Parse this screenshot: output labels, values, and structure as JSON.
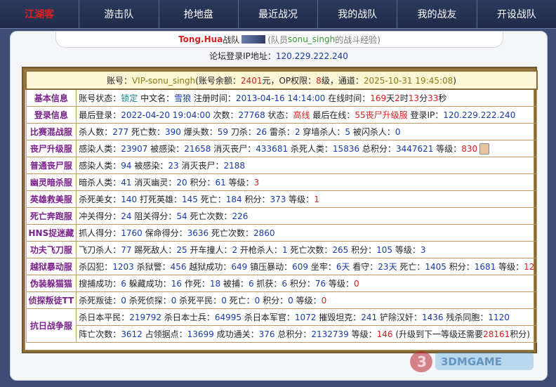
{
  "nav": {
    "logo": "江湖客",
    "items": [
      "游击队",
      "抢地盘",
      "最近战况",
      "我的战队",
      "我的战友",
      "开设战队"
    ]
  },
  "header": {
    "team_name": "Tong.Hua",
    "team_suffix": "战队",
    "member_prefix": "(队员",
    "member_name": "sonu_singh",
    "member_suffix": "的战斗经验)"
  },
  "ip": {
    "label": "论坛登录IP地址：",
    "value": "120.229.222.240"
  },
  "account": {
    "label": "账号：",
    "id": "VIP-sonu_singh",
    "balance_label": "(账号余额：",
    "balance": "2401",
    "balance_unit": "元，OP权限：",
    "op_level": "8",
    "op_unit": "级，通道：",
    "date": "2025-10-31 19:45:08",
    "close": ")"
  },
  "rows": [
    {
      "label": "基本信息",
      "parts": [
        {
          "t": "账号状态：",
          "c": ""
        },
        {
          "t": "锁定",
          "c": "teal"
        },
        {
          "t": " 中文名：",
          "c": ""
        },
        {
          "t": "雪狼",
          "c": "blue"
        },
        {
          "t": " 注册时间：",
          "c": ""
        },
        {
          "t": "2013-04-16 14:14:00",
          "c": "blue"
        },
        {
          "t": " 在线时间：",
          "c": ""
        },
        {
          "t": "169",
          "c": "red"
        },
        {
          "t": "天",
          "c": ""
        },
        {
          "t": "2",
          "c": "red"
        },
        {
          "t": "时",
          "c": ""
        },
        {
          "t": "13",
          "c": "red"
        },
        {
          "t": "分",
          "c": ""
        },
        {
          "t": "33",
          "c": "red"
        },
        {
          "t": "秒",
          "c": ""
        }
      ]
    },
    {
      "label": "登录信息",
      "parts": [
        {
          "t": "最后登录：",
          "c": ""
        },
        {
          "t": "2022-04-20 19:04:00",
          "c": "blue"
        },
        {
          "t": " 次数：",
          "c": ""
        },
        {
          "t": "27768",
          "c": "blue"
        },
        {
          "t": " 状态：",
          "c": ""
        },
        {
          "t": "高线",
          "c": "red"
        },
        {
          "t": " 最后在线：",
          "c": ""
        },
        {
          "t": "55丧尸升级服",
          "c": "red"
        },
        {
          "t": " 登录IP：",
          "c": ""
        },
        {
          "t": "120.229.222.240",
          "c": "blue"
        }
      ]
    },
    {
      "label": "比赛混战服",
      "parts": [
        {
          "t": "杀人数：",
          "c": ""
        },
        {
          "t": "277",
          "c": "blue"
        },
        {
          "t": " 死亡数：",
          "c": ""
        },
        {
          "t": "390",
          "c": "blue"
        },
        {
          "t": " 爆头数：",
          "c": ""
        },
        {
          "t": "59",
          "c": "blue"
        },
        {
          "t": " 刀杀：",
          "c": ""
        },
        {
          "t": "26",
          "c": "blue"
        },
        {
          "t": " 雷杀：",
          "c": ""
        },
        {
          "t": "2",
          "c": "blue"
        },
        {
          "t": " 穿墙杀人：",
          "c": ""
        },
        {
          "t": "5",
          "c": "blue"
        },
        {
          "t": " 被闪杀人：",
          "c": ""
        },
        {
          "t": "0",
          "c": "blue"
        }
      ]
    },
    {
      "label": "丧尸升级服",
      "avatar": true,
      "parts": [
        {
          "t": "感染人类：",
          "c": ""
        },
        {
          "t": "23907",
          "c": "blue"
        },
        {
          "t": " 被感染：",
          "c": ""
        },
        {
          "t": "21658",
          "c": "blue"
        },
        {
          "t": " 消灭丧尸：",
          "c": ""
        },
        {
          "t": "433681",
          "c": "blue"
        },
        {
          "t": " 杀死人类：",
          "c": ""
        },
        {
          "t": "15836",
          "c": "blue"
        },
        {
          "t": " 总积分：",
          "c": ""
        },
        {
          "t": "3447621",
          "c": "blue"
        },
        {
          "t": " 等级：",
          "c": ""
        },
        {
          "t": "830",
          "c": "red"
        }
      ]
    },
    {
      "label": "普通丧尸服",
      "parts": [
        {
          "t": "感染人类：",
          "c": ""
        },
        {
          "t": "94",
          "c": "blue"
        },
        {
          "t": " 被感染：",
          "c": ""
        },
        {
          "t": "23",
          "c": "blue"
        },
        {
          "t": " 消灭丧尸：",
          "c": ""
        },
        {
          "t": "2188",
          "c": "blue"
        }
      ]
    },
    {
      "label": "幽灵暗杀服",
      "parts": [
        {
          "t": "暗杀人类：",
          "c": ""
        },
        {
          "t": "41",
          "c": "blue"
        },
        {
          "t": " 消灭幽灵：",
          "c": ""
        },
        {
          "t": "20",
          "c": "blue"
        },
        {
          "t": " 积分：",
          "c": ""
        },
        {
          "t": "61",
          "c": "blue"
        },
        {
          "t": " 等级：",
          "c": ""
        },
        {
          "t": "3",
          "c": "red"
        }
      ]
    },
    {
      "label": "英雄救美服",
      "parts": [
        {
          "t": "杀死美女：",
          "c": ""
        },
        {
          "t": "140",
          "c": "blue"
        },
        {
          "t": " 打死英雄：",
          "c": ""
        },
        {
          "t": "145",
          "c": "blue"
        },
        {
          "t": " 死亡：",
          "c": ""
        },
        {
          "t": "184",
          "c": "blue"
        },
        {
          "t": " 积分：",
          "c": ""
        },
        {
          "t": "373",
          "c": "blue"
        },
        {
          "t": " 等级：",
          "c": ""
        },
        {
          "t": "1",
          "c": "red"
        }
      ]
    },
    {
      "label": "死亡奔跑服",
      "parts": [
        {
          "t": "冲关得分：",
          "c": ""
        },
        {
          "t": "24",
          "c": "blue"
        },
        {
          "t": " 阻关得分：",
          "c": ""
        },
        {
          "t": "54",
          "c": "blue"
        },
        {
          "t": " 死亡次数：",
          "c": ""
        },
        {
          "t": "226",
          "c": "blue"
        }
      ]
    },
    {
      "label": "HNS捉迷藏",
      "parts": [
        {
          "t": "抓人得分：",
          "c": ""
        },
        {
          "t": "1760",
          "c": "blue"
        },
        {
          "t": " 保命得分：",
          "c": ""
        },
        {
          "t": "3636",
          "c": "blue"
        },
        {
          "t": " 死亡次数：",
          "c": ""
        },
        {
          "t": "2860",
          "c": "blue"
        }
      ]
    },
    {
      "label": "功夫飞刀服",
      "parts": [
        {
          "t": "飞刀杀人：",
          "c": ""
        },
        {
          "t": "77",
          "c": "blue"
        },
        {
          "t": " 踢死敌人：",
          "c": ""
        },
        {
          "t": "25",
          "c": "blue"
        },
        {
          "t": " 开车撞人：",
          "c": ""
        },
        {
          "t": "2",
          "c": "blue"
        },
        {
          "t": " 开枪杀人：",
          "c": ""
        },
        {
          "t": "1",
          "c": "blue"
        },
        {
          "t": " 死亡次数：",
          "c": ""
        },
        {
          "t": "265",
          "c": "blue"
        },
        {
          "t": " 积分：",
          "c": ""
        },
        {
          "t": "105",
          "c": "blue"
        },
        {
          "t": " 等级：",
          "c": ""
        },
        {
          "t": "3",
          "c": "blue"
        }
      ]
    },
    {
      "label": "越狱暴动服",
      "parts": [
        {
          "t": "杀囚犯：",
          "c": ""
        },
        {
          "t": "1203",
          "c": "blue"
        },
        {
          "t": " 杀狱警：",
          "c": ""
        },
        {
          "t": "456",
          "c": "blue"
        },
        {
          "t": " 越狱成功：",
          "c": ""
        },
        {
          "t": "649",
          "c": "blue"
        },
        {
          "t": " 镇压暴动：",
          "c": ""
        },
        {
          "t": "609",
          "c": "blue"
        },
        {
          "t": " 坐牢：",
          "c": ""
        },
        {
          "t": "6天",
          "c": "blue"
        },
        {
          "t": " 看守：",
          "c": ""
        },
        {
          "t": "23天",
          "c": "blue"
        },
        {
          "t": " 死亡：",
          "c": ""
        },
        {
          "t": "1405",
          "c": "blue"
        },
        {
          "t": " 积分：",
          "c": ""
        },
        {
          "t": "1681",
          "c": "blue"
        },
        {
          "t": " 等级：",
          "c": ""
        },
        {
          "t": "12",
          "c": "red"
        }
      ]
    },
    {
      "label": "伪装躲猫猫",
      "parts": [
        {
          "t": "搜捕成功：",
          "c": ""
        },
        {
          "t": "6",
          "c": "blue"
        },
        {
          "t": " 躲藏成功：",
          "c": ""
        },
        {
          "t": "16",
          "c": "blue"
        },
        {
          "t": " 作死：",
          "c": ""
        },
        {
          "t": "18",
          "c": "blue"
        },
        {
          "t": " 被捕：",
          "c": ""
        },
        {
          "t": "6",
          "c": "blue"
        },
        {
          "t": " 抓获：",
          "c": ""
        },
        {
          "t": "6",
          "c": "blue"
        },
        {
          "t": " 积分：",
          "c": ""
        },
        {
          "t": "76",
          "c": "blue"
        },
        {
          "t": " 等级：",
          "c": ""
        },
        {
          "t": "0",
          "c": "red"
        }
      ]
    },
    {
      "label": "侦探叛徒TT",
      "parts": [
        {
          "t": "杀死叛徒：",
          "c": ""
        },
        {
          "t": "0",
          "c": "blue"
        },
        {
          "t": " 杀死侦探：",
          "c": ""
        },
        {
          "t": "0",
          "c": "blue"
        },
        {
          "t": " 杀死平民：",
          "c": ""
        },
        {
          "t": "0",
          "c": "blue"
        },
        {
          "t": " 死亡：",
          "c": ""
        },
        {
          "t": "0",
          "c": "blue"
        },
        {
          "t": " 积分：",
          "c": ""
        },
        {
          "t": "0",
          "c": "blue"
        },
        {
          "t": " 等级：",
          "c": ""
        },
        {
          "t": "0",
          "c": "red"
        }
      ]
    }
  ],
  "war_row": {
    "label": "抗日战争服",
    "line1": [
      {
        "t": "杀日本平民：",
        "c": ""
      },
      {
        "t": "219792",
        "c": "blue"
      },
      {
        "t": " 杀日本士兵：",
        "c": ""
      },
      {
        "t": "64995",
        "c": "blue"
      },
      {
        "t": " 杀日本军官：",
        "c": ""
      },
      {
        "t": "1072",
        "c": "blue"
      },
      {
        "t": " 摧毁坦克：",
        "c": ""
      },
      {
        "t": "241",
        "c": "blue"
      },
      {
        "t": " 铲除汉奸：",
        "c": ""
      },
      {
        "t": "1436",
        "c": "blue"
      },
      {
        "t": " 残杀同胞：",
        "c": ""
      },
      {
        "t": "1120",
        "c": "blue"
      }
    ],
    "line2": [
      {
        "t": "阵亡次数：",
        "c": ""
      },
      {
        "t": "3612",
        "c": "blue"
      },
      {
        "t": " 占领据点：",
        "c": ""
      },
      {
        "t": "13699",
        "c": "blue"
      },
      {
        "t": " 成功通关：",
        "c": ""
      },
      {
        "t": "376",
        "c": "blue"
      },
      {
        "t": " 总积分：",
        "c": ""
      },
      {
        "t": "2132739",
        "c": "blue"
      },
      {
        "t": " 等级：",
        "c": ""
      },
      {
        "t": "146",
        "c": "red"
      },
      {
        "t": " (升级到下一等级还需要",
        "c": ""
      },
      {
        "t": "28161",
        "c": "red"
      },
      {
        "t": "积分)",
        "c": ""
      }
    ]
  },
  "watermark": {
    "text": "3DMGAME"
  }
}
